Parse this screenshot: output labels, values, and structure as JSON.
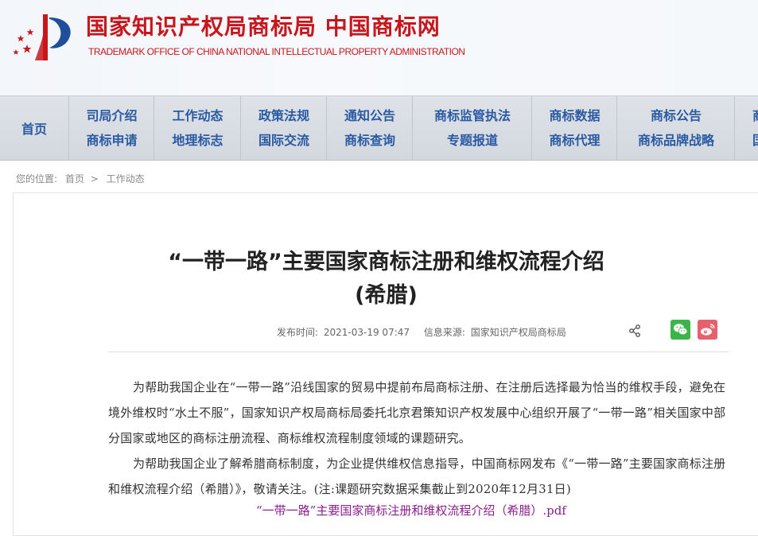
{
  "header": {
    "title": "国家知识产权局商标局 中国商标网",
    "subtitle": "TRADEMARK OFFICE OF CHINA NATIONAL INTELLECTUAL PROPERTY ADMINISTRATION"
  },
  "nav": {
    "home": "首页",
    "columns": [
      [
        "司局介绍",
        "商标申请"
      ],
      [
        "工作动态",
        "地理标志"
      ],
      [
        "政策法规",
        "国际交流"
      ],
      [
        "通知公告",
        "商标查询"
      ],
      [
        "商标监管执法",
        "专题报道"
      ],
      [
        "商标数据",
        "商标代理"
      ],
      [
        "商标公告",
        "商标品牌战略"
      ],
      [
        "商",
        "国"
      ]
    ]
  },
  "breadcrumb": {
    "prefix": "您的位置:",
    "home": "首页",
    "separator": ">",
    "current": "工作动态"
  },
  "article": {
    "title_line1": "“一带一路”主要国家商标注册和维权流程介绍",
    "title_line2": "(希腊)",
    "meta_time_label": "发布时间:",
    "meta_time": "2021-03-19 07:47",
    "meta_source_label": "信息来源:",
    "meta_source": "国家知识产权局商标局",
    "paragraph1": "为帮助我国企业在“一带一路”沿线国家的贸易中提前布局商标注册、在注册后选择最为恰当的维权手段，避免在境外维权时“水土不服”，国家知识产权局商标局委托北京君策知识产权发展中心组织开展了“一带一路”相关国家中部分国家或地区的商标注册流程、商标维权流程制度领域的课题研究。",
    "paragraph2": "为帮助我国企业了解希腊商标制度，为企业提供维权信息指导，中国商标网发布《“一带一路”主要国家商标注册和维权流程介绍（希腊）》，敬请关注。(注:课题研究数据采集截止到2020年12月31日)",
    "pdf_link": "“一带一路”主要国家商标注册和维权流程介绍（希腊）.pdf"
  },
  "icons": {
    "logo": "cnipa-logo",
    "share": "share-icon",
    "wechat": "wechat-icon",
    "weibo": "weibo-icon"
  },
  "colors": {
    "brand_red": "#c8161d",
    "nav_blue": "#2a5aa3",
    "wechat_green": "#3bb54a",
    "weibo_red": "#e8606b",
    "link_purple": "#8a1f8a"
  }
}
